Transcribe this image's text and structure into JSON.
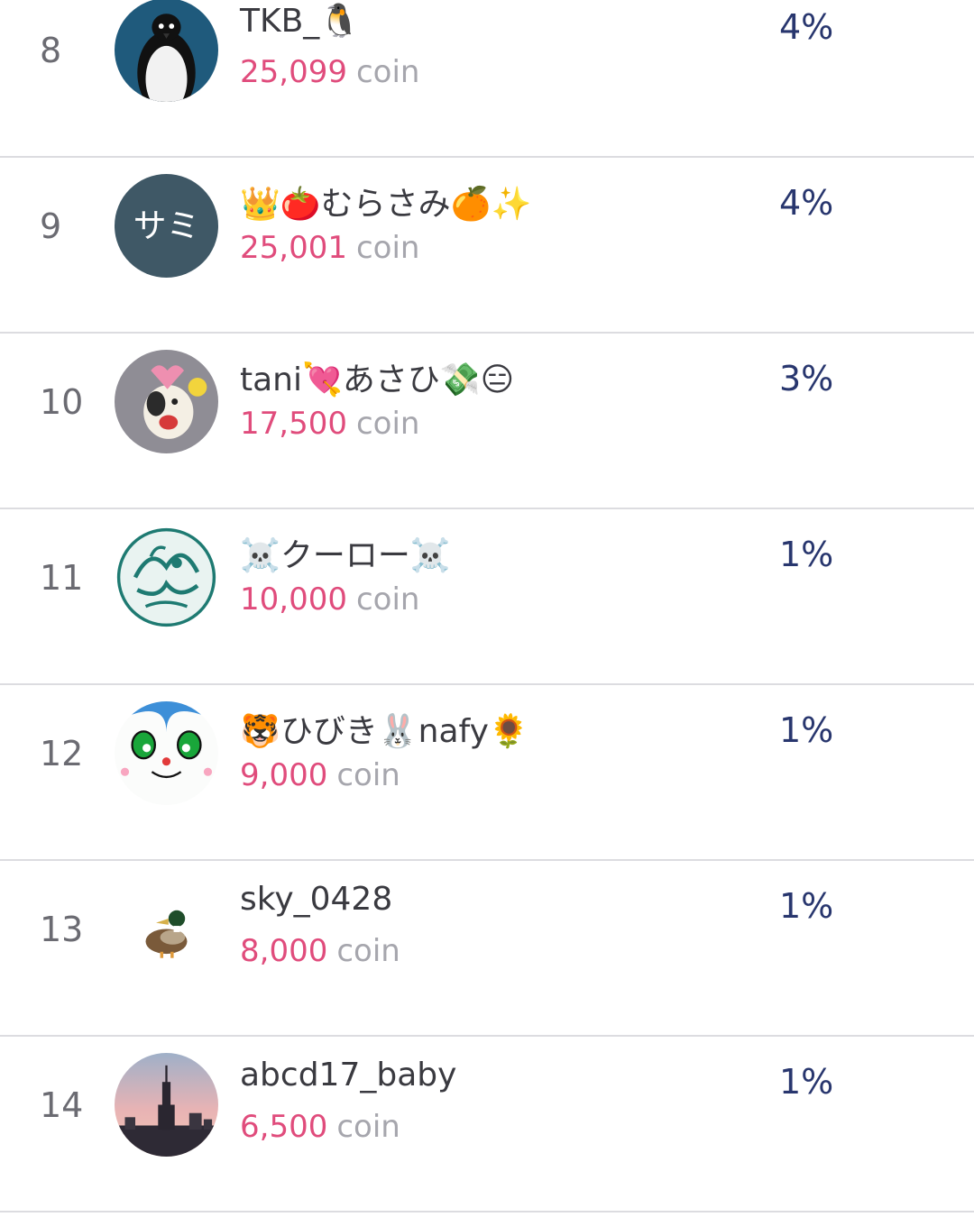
{
  "ranking": {
    "coin_unit": "coin",
    "rows": [
      {
        "rank": "8",
        "name": "TKB_🐧",
        "coins": "25,099",
        "percent": "4%",
        "avatar_icon": "penguin-avatar-icon"
      },
      {
        "rank": "9",
        "name": "👑🍅むらさみ🍊✨",
        "coins": "25,001",
        "percent": "4%",
        "avatar_icon": "initials-avatar-icon",
        "avatar_text": "サミ"
      },
      {
        "rank": "10",
        "name": "tani💘あさひ💸😑",
        "coins": "17,500",
        "percent": "3%",
        "avatar_icon": "dog-drawing-avatar-icon"
      },
      {
        "rank": "11",
        "name": "☠️クーロー☠️",
        "coins": "10,000",
        "percent": "1%",
        "avatar_icon": "phoenix-pattern-avatar-icon"
      },
      {
        "rank": "12",
        "name": "🐯ひびき🐰nafy🌻",
        "coins": "9,000",
        "percent": "1%",
        "avatar_icon": "cartoon-face-avatar-icon"
      },
      {
        "rank": "13",
        "name": "sky_0428",
        "coins": "8,000",
        "percent": "1%",
        "avatar_icon": "duck-avatar-icon"
      },
      {
        "rank": "14",
        "name": "abcd17_baby",
        "coins": "6,500",
        "percent": "1%",
        "avatar_icon": "city-skyline-avatar-icon"
      }
    ]
  },
  "colors": {
    "coin_amount": "#e04c7c",
    "coin_unit": "#a6a6ad",
    "percent": "#28366e",
    "rank": "#6b6b72",
    "name": "#3a3a40",
    "divider": "#dcdce0"
  }
}
